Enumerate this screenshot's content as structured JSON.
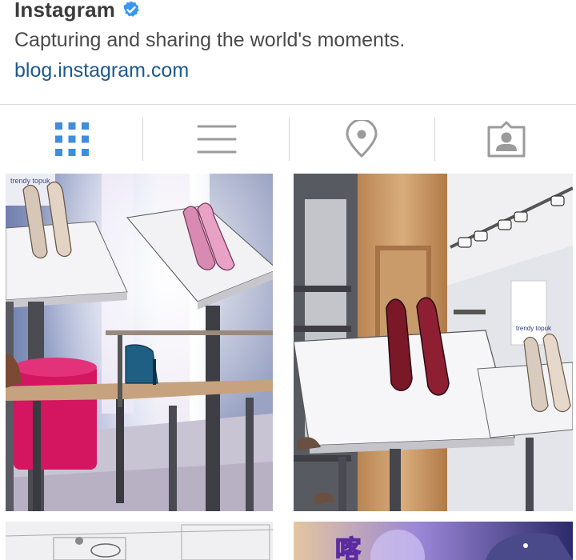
{
  "profile": {
    "username": "Instagram",
    "verified": true,
    "bio": "Capturing and sharing the world's moments.",
    "website": "blog.instagram.com"
  },
  "tabs": [
    {
      "id": "grid",
      "icon": "grid-icon",
      "active": true
    },
    {
      "id": "list",
      "icon": "list-icon",
      "active": false
    },
    {
      "id": "map",
      "icon": "location-pin-icon",
      "active": false
    },
    {
      "id": "tagged",
      "icon": "tagged-person-icon",
      "active": false
    }
  ],
  "colors": {
    "active_tab": "#3f8ddb",
    "inactive_tab": "#9b9b9b",
    "verified_badge": "#3897f0",
    "link": "#1f5a8c"
  },
  "posts": {
    "post_1": {
      "store_sign": "trendy topuk"
    },
    "post_2": {
      "store_sign": "trendy topuk"
    },
    "post_4": {
      "overlay_text": "喀"
    }
  }
}
